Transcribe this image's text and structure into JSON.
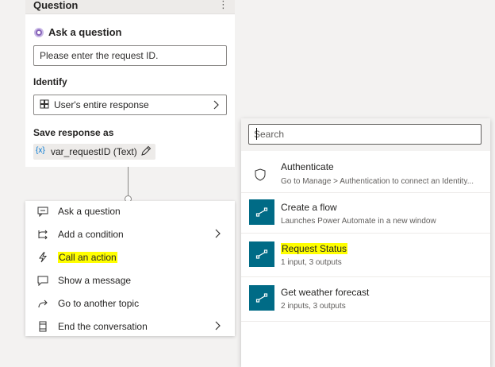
{
  "question_card": {
    "header": "Question",
    "more_glyph": "⋮",
    "ask_label": "Ask a question",
    "question_text": "Please enter the request ID.",
    "identify_label": "Identify",
    "identify_value": "User's entire response",
    "save_label": "Save response as",
    "variable_glyph": "{x}",
    "variable_name": "var_requestID (Text)"
  },
  "add_menu": {
    "items": [
      {
        "label": "Ask a question",
        "icon": "chat-question-icon"
      },
      {
        "label": "Add a condition",
        "icon": "branch-icon",
        "has_submenu": true
      },
      {
        "label": "Call an action",
        "icon": "lightning-icon",
        "highlighted": true
      },
      {
        "label": "Show a message",
        "icon": "message-icon"
      },
      {
        "label": "Go to another topic",
        "icon": "redirect-arrow-icon"
      },
      {
        "label": "End the conversation",
        "icon": "end-icon",
        "has_submenu": true
      }
    ]
  },
  "action_panel": {
    "search_placeholder": "Search",
    "actions": [
      {
        "title": "Authenticate",
        "subtitle": "Go to Manage > Authentication to connect an Identity...",
        "icon": "shield-icon"
      },
      {
        "title": "Create a flow",
        "subtitle": "Launches Power Automate in a new window",
        "icon": "flow-icon"
      },
      {
        "title": "Request Status",
        "subtitle": "1 input, 3 outputs",
        "icon": "flow-icon",
        "highlighted": true
      },
      {
        "title": "Get weather forecast",
        "subtitle": "2 inputs, 3 outputs",
        "icon": "flow-icon"
      }
    ]
  },
  "colors": {
    "accent_purple": "#8764b8",
    "flow_teal": "#006b86",
    "highlight_yellow": "#ffff00",
    "background": "#f3f2f1"
  }
}
